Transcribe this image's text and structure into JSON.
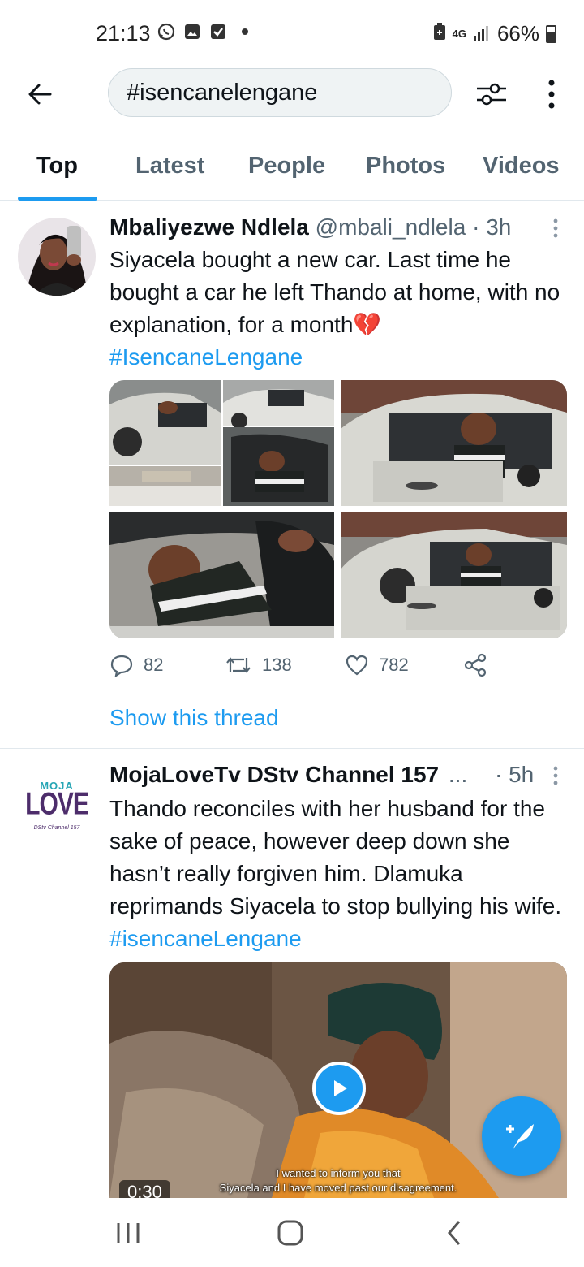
{
  "status_bar": {
    "time": "21:13",
    "network": "4G",
    "battery": "66%",
    "icons": [
      "whatsapp-icon",
      "gallery-icon",
      "checkbox-icon",
      "dot-icon",
      "signal-icon",
      "battery-icon"
    ]
  },
  "search": {
    "query": "#isencanelengane"
  },
  "tabs": [
    "Top",
    "Latest",
    "People",
    "Photos",
    "Videos"
  ],
  "active_tab": "Top",
  "tweets": [
    {
      "name": "Mbaliyezwe Ndlela",
      "handle": "@mbali_ndlela",
      "separator": "·",
      "time": "3h",
      "text": "Siyacela bought a new car. Last time he bought a car he left Thando at home, with no explanation, for a month💔",
      "hashtag": "#IsencaneLengane",
      "replies": "82",
      "retweets": "138",
      "likes": "782",
      "show_thread": "Show this thread"
    },
    {
      "name": "MojaLoveTv DStv Channel 157",
      "ellipsis": "...",
      "separator": "·",
      "time": "5h",
      "text": "Thando reconciles with her husband for the sake of peace, however deep down she hasn’t really forgiven him. Dlamuka reprimands Siyacela to stop bullying his wife.",
      "hashtag": "#isencaneLengane",
      "avatar_line1": "MOJA",
      "avatar_line2": "LOVE",
      "avatar_line3": "DStv Channel 157",
      "video_duration": "0:30",
      "caption_line1": "I wanted to inform you that",
      "caption_line2": "Siyacela and I have moved past our disagreement."
    }
  ],
  "colors": {
    "accent": "#1d9bf0",
    "text": "#0f1419",
    "secondary": "#536471"
  }
}
